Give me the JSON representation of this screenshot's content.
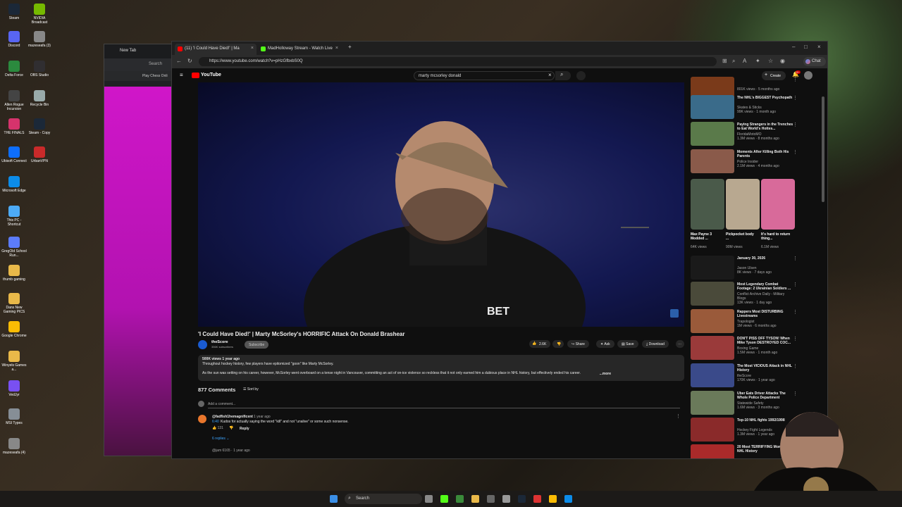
{
  "desktop_icons": [
    {
      "label": "Steam",
      "color": "#1b2838"
    },
    {
      "label": "NVIDIA Broadcast",
      "color": "#76b900"
    },
    {
      "label": "Discord",
      "color": "#5865f2"
    },
    {
      "label": "mazeseafa (3)",
      "color": "#888"
    },
    {
      "label": "Delta Force",
      "color": "#2b8a3e"
    },
    {
      "label": "OBS Studio",
      "color": "#302e31"
    },
    {
      "label": "Allen Rogue Incursion",
      "color": "#444"
    },
    {
      "label": "Recycle Bin",
      "color": "#9aa"
    },
    {
      "label": "THE FINALS",
      "color": "#d6336c"
    },
    {
      "label": "Steam - Copy",
      "color": "#1b2838"
    },
    {
      "label": "Ubisoft Connect",
      "color": "#0d6efd"
    },
    {
      "label": "UrbanVPN",
      "color": "#c92a2a"
    },
    {
      "label": "Microsoft Edge",
      "color": "#0c8ce9"
    },
    {
      "label": "This PC - Shortcut",
      "color": "#4dabf7"
    },
    {
      "label": "GregOld School Run...",
      "color": "#5c7cfa"
    },
    {
      "label": "thumb gaming",
      "color": "#e9b949"
    },
    {
      "label": "Dans New Gaming PICS",
      "color": "#e9b949"
    },
    {
      "label": "Google Chrome",
      "color": "#fbbc04"
    },
    {
      "label": "Winyels Games a...",
      "color": "#e9b949"
    },
    {
      "label": "VedJyr",
      "color": "#7950f2"
    },
    {
      "label": "MSI Types",
      "color": "#868e96"
    },
    {
      "label": "mazeseafa (4)",
      "color": "#888"
    }
  ],
  "bg_window": {
    "tab": "New Tab",
    "search": "Search",
    "bookmark": "Play Chess Onli"
  },
  "browser": {
    "tabs": [
      {
        "label": "(11) 'I Could Have Died!' | Ma"
      },
      {
        "label": "MadHolloway Stream - Watch Live"
      }
    ],
    "url": "https://www.youtube.com/watch?v=pHzGfbxbS0Q",
    "chat_label": "Chat"
  },
  "youtube": {
    "logo": "YouTube",
    "search": "marty mcsorley donald",
    "create": "Create",
    "notif_count": "9+",
    "player_brand": "BET",
    "title": "'I Could Have Died!' | Marty McSorley's HORRIFIC Attack On Donald Brashear",
    "channel": "theScore",
    "subs": "356K subscribers",
    "subscribe": "Subscribe",
    "likes": "2.6K",
    "share": "Share",
    "ask": "Ask",
    "save": "Save",
    "download": "Download",
    "desc_meta": "500K views  1 year ago",
    "desc_line1": "Throughout hockey history, few players have epitomized \"goon\" like Marty McSorley.",
    "desc_line2": "As the sun was setting on his career, however, McSorley went overboard on a tense night in Vancouver, committing an act of on-ice violence so reckless that it not only earned him a dubious place in NHL history, but effectively ended his career.",
    "more": "...more",
    "comments_count": "877 Comments",
    "sort": "Sort by",
    "add_comment": "Add a comment...",
    "comment": {
      "user": "@fadfish1hemagnificent",
      "time": "1 year ago",
      "ts": "6:40",
      "text": "Kudos for actually saying the word \"kill\" and not \"unalive\" or some such nonsense.",
      "likes": "131",
      "reply": "Reply",
      "replies": "6 replies"
    },
    "comment2_user": "@jam 6165 · 1 year ago"
  },
  "recs": [
    {
      "title": "",
      "meta": "801K views · 5 months ago",
      "color": "#7a3a1a"
    },
    {
      "title": "The NHL's BIGGEST Psychopath",
      "meta": "Skates & Sticks\n99K views · 1 month ago",
      "color": "#3a6b8a"
    },
    {
      "title": "Paying Strangers in the Trenches to Eat World's Hottes...",
      "meta": "FloridaMotoMO\n1.3M views · 8 months ago",
      "color": "#5a7a4a"
    },
    {
      "title": "Moments After Killing Both His Parents",
      "meta": "Police Insider\n2.1M views · 4 months ago",
      "color": "#8a5a4a"
    }
  ],
  "shorts": [
    {
      "title": "Max Payne 3 Modded ...",
      "meta": "64K views",
      "color": "#4a5a4a"
    },
    {
      "title": "Pickpocket body ...",
      "meta": "90M views",
      "color": "#b8a890"
    },
    {
      "title": "It's hard to return thing...",
      "meta": "6.1M views",
      "color": "#d86a9a"
    }
  ],
  "recs2": [
    {
      "title": "January 30, 2026",
      "meta": "Jason Ulsen\n8K views · 7 days ago",
      "color": "#1a1a1a"
    },
    {
      "title": "Most Legendary Combat Footage: 2 Ukrainian Soldiers ...",
      "meta": "Conflict Archive Daily - Military Blogs\n13K views · 1 day ago",
      "color": "#4a4a3a"
    },
    {
      "title": "Rappers Most DISTURBING Livestreams",
      "meta": "Trapologist\n1M views · 6 months ago",
      "color": "#9a5a3a"
    },
    {
      "title": "DON'T PISS OFF TYSON! When Mike Tyson DESTROYED COC...",
      "meta": "Boxing Game\n1.5M views · 1 month ago",
      "color": "#9a3a3a"
    },
    {
      "title": "The Most VICIOUS Attack in NHL History",
      "meta": "theScore\n170K views · 1 year ago",
      "color": "#3a4a8a"
    },
    {
      "title": "Uber Eats Driver Attacks The Whole Police Department",
      "meta": "Statewide Safety\n1.6M views · 3 months ago",
      "color": "#6a7a5a"
    },
    {
      "title": "Top-10 NHL fights 1992/1998",
      "meta": "Hockey Fight Legends\n1.3M views · 1 year ago",
      "color": "#8a2a2a"
    },
    {
      "title": "20 Most TERRIFYING Moments in NHL History",
      "meta": "",
      "color": "#aa2a2a"
    }
  ],
  "taskbar": {
    "search": "Search"
  }
}
